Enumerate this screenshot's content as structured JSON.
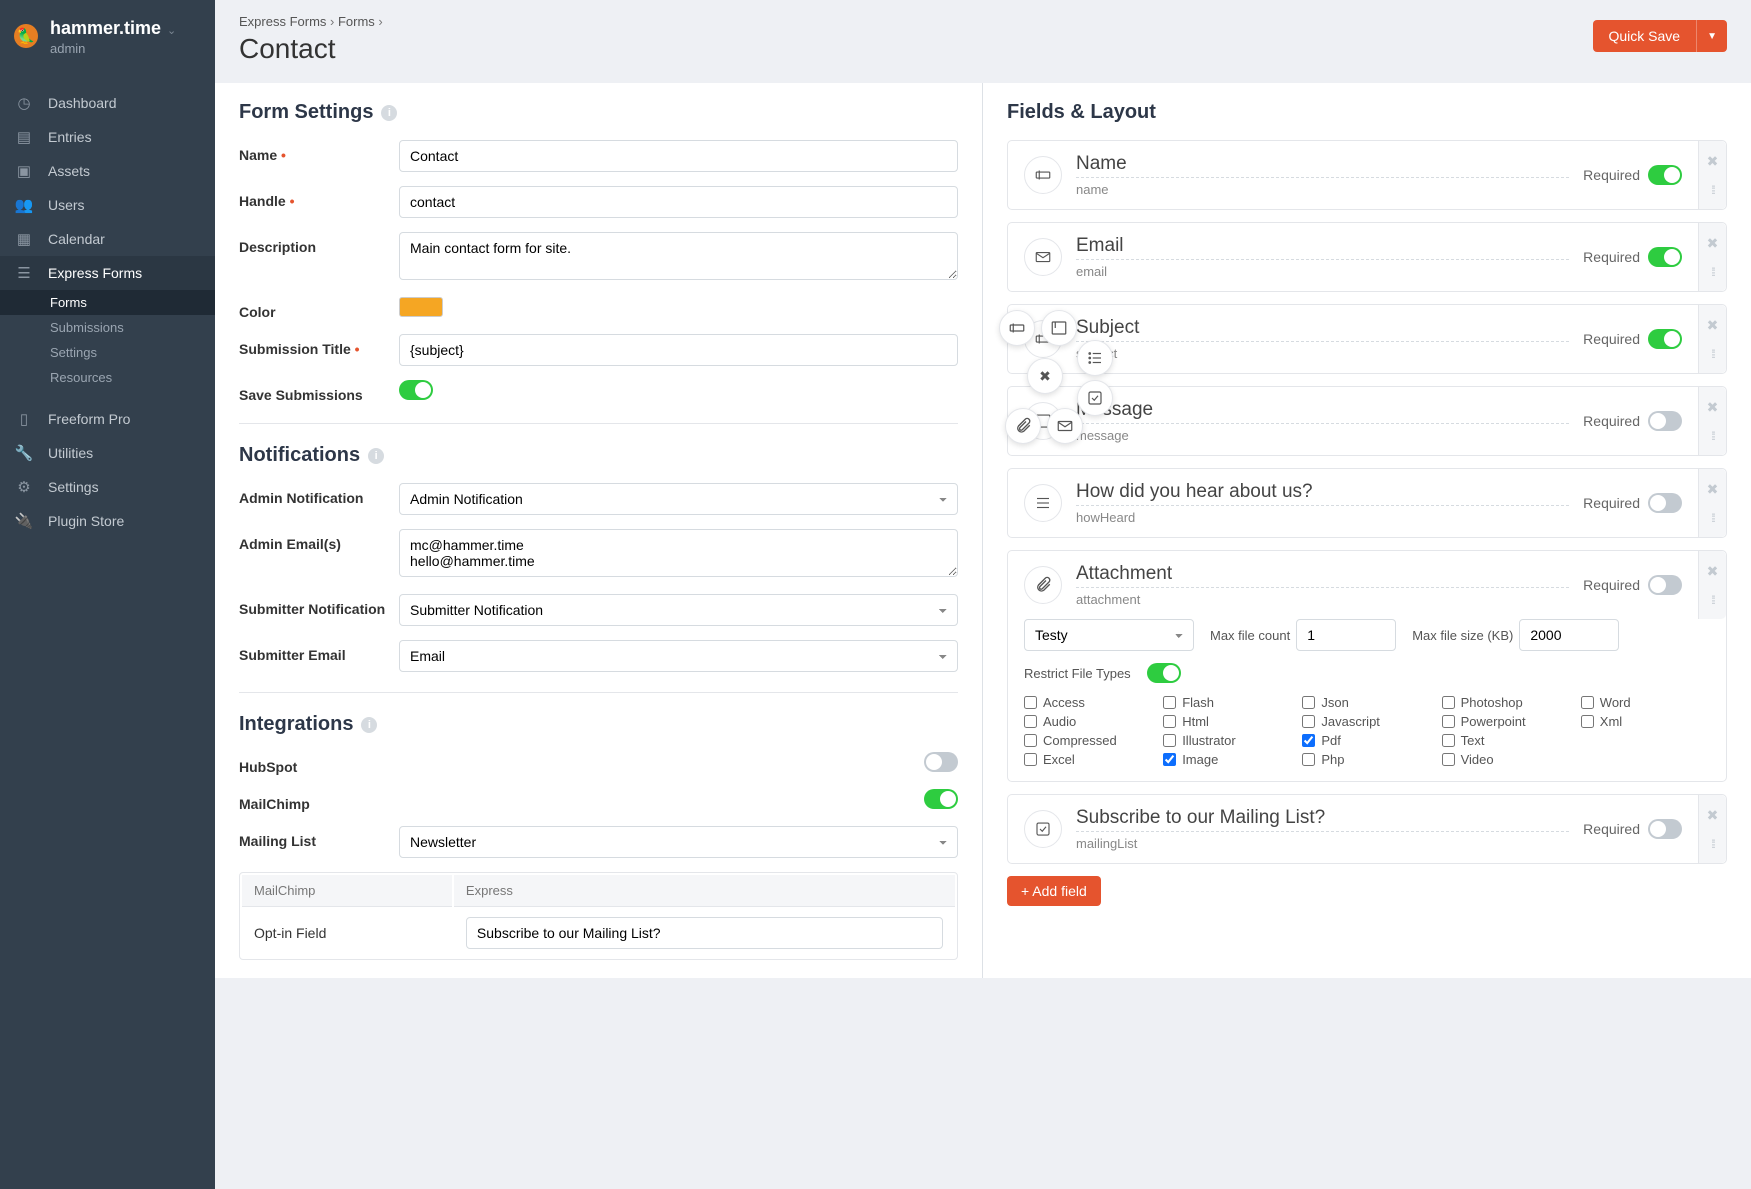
{
  "site": {
    "name": "hammer.time",
    "role": "admin"
  },
  "nav": {
    "items": [
      {
        "label": "Dashboard"
      },
      {
        "label": "Entries"
      },
      {
        "label": "Assets"
      },
      {
        "label": "Users"
      },
      {
        "label": "Calendar"
      },
      {
        "label": "Express Forms"
      }
    ],
    "sub": [
      {
        "label": "Forms"
      },
      {
        "label": "Submissions"
      },
      {
        "label": "Settings"
      },
      {
        "label": "Resources"
      }
    ],
    "items2": [
      {
        "label": "Freeform Pro"
      },
      {
        "label": "Utilities"
      },
      {
        "label": "Settings"
      },
      {
        "label": "Plugin Store"
      }
    ]
  },
  "breadcrumbs": {
    "a": "Express Forms",
    "b": "Forms"
  },
  "page_title": "Contact",
  "save_btn": "Quick Save",
  "sections": {
    "form_settings": "Form Settings",
    "notifications": "Notifications",
    "integrations": "Integrations",
    "fields": "Fields & Layout"
  },
  "form": {
    "name_label": "Name",
    "name_value": "Contact",
    "handle_label": "Handle",
    "handle_value": "contact",
    "desc_label": "Description",
    "desc_value": "Main contact form for site.",
    "color_label": "Color",
    "color_value": "#f5a623",
    "subtitle_label": "Submission Title",
    "subtitle_value": "{subject}",
    "savesub_label": "Save Submissions"
  },
  "notif": {
    "admin_notif_label": "Admin Notification",
    "admin_notif_value": "Admin Notification",
    "admin_email_label": "Admin Email(s)",
    "admin_email_value": "mc@hammer.time\nhello@hammer.time",
    "submitter_notif_label": "Submitter Notification",
    "submitter_notif_value": "Submitter Notification",
    "submitter_email_label": "Submitter Email",
    "submitter_email_value": "Email"
  },
  "integ": {
    "hubspot": "HubSpot",
    "mailchimp": "MailChimp",
    "mailing_list_label": "Mailing List",
    "mailing_list_value": "Newsletter",
    "tbl_h1": "MailChimp",
    "tbl_h2": "Express",
    "tbl_c1": "Opt-in Field",
    "tbl_c2": "Subscribe to our Mailing List?"
  },
  "fields": [
    {
      "name": "Name",
      "handle": "name",
      "type": "text",
      "required": true
    },
    {
      "name": "Email",
      "handle": "email",
      "type": "email",
      "required": true
    },
    {
      "name": "Subject",
      "handle": "subject",
      "type": "text",
      "required": true
    },
    {
      "name": "Message",
      "handle": "message",
      "type": "textarea",
      "required": false
    },
    {
      "name": "How did you hear about us?",
      "handle": "howHeard",
      "type": "options",
      "required": false
    },
    {
      "name": "Attachment",
      "handle": "attachment",
      "type": "file",
      "required": false
    },
    {
      "name": "Subscribe to our Mailing List?",
      "handle": "mailingList",
      "type": "checkbox",
      "required": false
    }
  ],
  "required_label": "Required",
  "attachment": {
    "source": "Testy",
    "max_count_label": "Max file count",
    "max_count": "1",
    "max_size_label": "Max file size (KB)",
    "max_size": "2000",
    "restrict_label": "Restrict File Types",
    "types": [
      {
        "l": "Access",
        "c": false
      },
      {
        "l": "Flash",
        "c": false
      },
      {
        "l": "Json",
        "c": false
      },
      {
        "l": "Photoshop",
        "c": false
      },
      {
        "l": "Word",
        "c": false
      },
      {
        "l": "Audio",
        "c": false
      },
      {
        "l": "Html",
        "c": false
      },
      {
        "l": "Javascript",
        "c": false
      },
      {
        "l": "Powerpoint",
        "c": false
      },
      {
        "l": "Xml",
        "c": false
      },
      {
        "l": "Compressed",
        "c": false
      },
      {
        "l": "Illustrator",
        "c": false
      },
      {
        "l": "Pdf",
        "c": true
      },
      {
        "l": "Text",
        "c": false
      },
      {
        "l": "",
        "c": false
      },
      {
        "l": "Excel",
        "c": false
      },
      {
        "l": "Image",
        "c": true
      },
      {
        "l": "Php",
        "c": false
      },
      {
        "l": "Video",
        "c": false
      },
      {
        "l": "",
        "c": false
      }
    ]
  },
  "add_field": "Add field"
}
